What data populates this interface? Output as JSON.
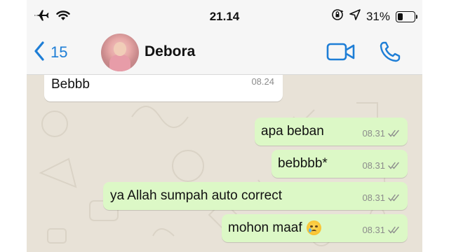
{
  "status_bar": {
    "time": "21.14",
    "battery_percent": "31%",
    "battery_level": 0.31,
    "icons": [
      "airplane-icon",
      "wifi-icon",
      "orientation-lock-icon",
      "location-arrow-icon",
      "battery-icon"
    ]
  },
  "header": {
    "back_count": "15",
    "contact_name": "Debora",
    "icons": [
      "chevron-left-icon",
      "video-call-icon",
      "phone-call-icon"
    ]
  },
  "colors": {
    "accent": "#1e7ed6",
    "incoming_bubble": "#ffffff",
    "outgoing_bubble": "#dcf8c6",
    "wallpaper": "#e8e2d7",
    "read_ticks": "#8c8c8c"
  },
  "messages": [
    {
      "direction": "in",
      "text": "Bebbb",
      "time": "08.24"
    },
    {
      "direction": "out",
      "text": "apa beban",
      "time": "08.31"
    },
    {
      "direction": "out",
      "text": "bebbbb*",
      "time": "08.31"
    },
    {
      "direction": "out",
      "text": "ya Allah sumpah auto correct",
      "time": "08.31"
    },
    {
      "direction": "out",
      "text": "mohon maaf",
      "emoji": "crying-face-emoji",
      "time": "08.31"
    }
  ]
}
